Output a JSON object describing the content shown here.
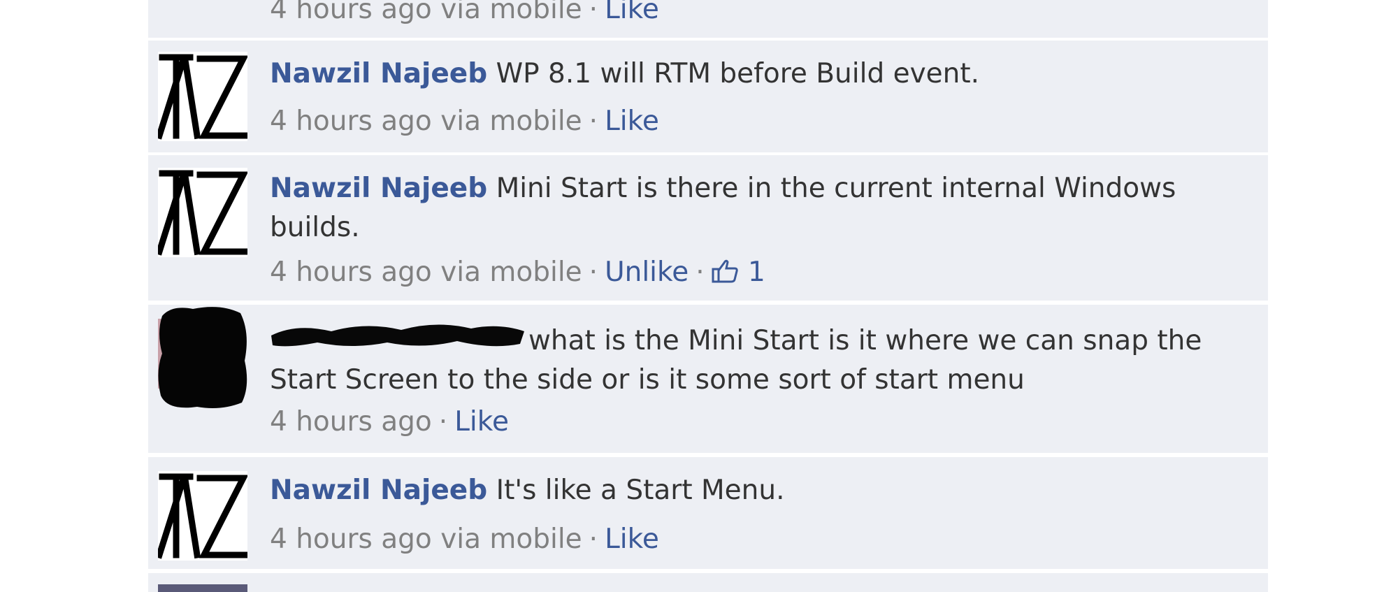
{
  "comments": [
    {
      "meta": {
        "time": "4 hours ago",
        "via": "via mobile",
        "action": "Like"
      }
    },
    {
      "author": "Nawzil Najeeb",
      "text": "WP 8.1 will RTM before Build event.",
      "meta": {
        "time": "4 hours ago",
        "via": "via mobile",
        "action": "Like"
      }
    },
    {
      "author": "Nawzil Najeeb",
      "text": "Mini Start is there in the current internal Windows builds.",
      "meta": {
        "time": "4 hours ago",
        "via": "via mobile",
        "action": "Unlike",
        "like_count": "1"
      }
    },
    {
      "author": "",
      "text": "what is the Mini Start is it where we can snap the Start Screen to the side or is it some sort of start menu",
      "meta": {
        "time": "4 hours ago",
        "action": "Like"
      }
    },
    {
      "author": "Nawzil Najeeb",
      "text": "It's like a Start Menu.",
      "meta": {
        "time": "4 hours ago",
        "via": "via mobile",
        "action": "Like"
      }
    }
  ],
  "colors": {
    "link": "#3b5998",
    "row_bg": "#edeff4",
    "meta": "#808080",
    "text": "#333333"
  },
  "icons": {
    "like": "thumbs-up-icon",
    "nz_avatar": "nz-monogram-logo"
  }
}
